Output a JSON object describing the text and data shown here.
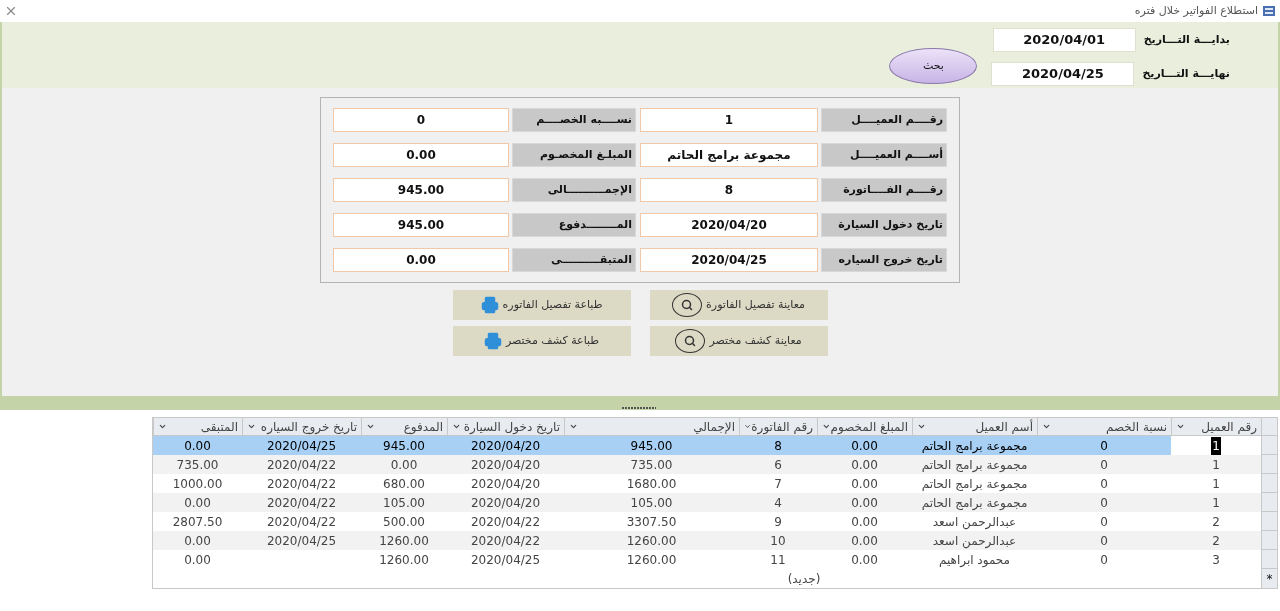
{
  "window": {
    "title": "استطلاع الفواتير خلال فتره"
  },
  "filter": {
    "start_label": "بدايـــة التـــاريخ",
    "start_value": "2020/04/01",
    "end_label": "نهايـــة التـــاريخ",
    "end_value": "2020/04/25",
    "search_button": "بحث"
  },
  "details": [
    {
      "label": "رقــــم العميــــل",
      "value": "1"
    },
    {
      "label": "نســــبه الخصــــم",
      "value": "0"
    },
    {
      "label": "أســــم العميــــل",
      "value": "مجموعة برامج الحاتم"
    },
    {
      "label": "المبلـغ المخصـوم",
      "value": "0.00"
    },
    {
      "label": "رقــــم الفــــاتورة",
      "value": "8"
    },
    {
      "label": "الإجمــــــــــالى",
      "value": "945.00"
    },
    {
      "label": "تاريخ  دخول السيارة",
      "value": "2020/04/20"
    },
    {
      "label": "المــــــــدفوع",
      "value": "945.00"
    },
    {
      "label": "تاريخ  خروج السياره",
      "value": "2020/04/25"
    },
    {
      "label": "المتبقــــــــــى",
      "value": "0.00"
    }
  ],
  "actions": [
    {
      "kind": "preview",
      "label": "معاينة تفصيل الفاتورة"
    },
    {
      "kind": "print",
      "label": "طباعة تفصيل الفاتوره"
    },
    {
      "kind": "preview",
      "label": "معاينة كشف مختصر"
    },
    {
      "kind": "print",
      "label": "طباعة كشف مختصر"
    }
  ],
  "grid": {
    "columns": [
      "رقم العميل",
      "نسبة الخصم",
      "أسم العميل",
      "المبلغ المخصوم",
      "رقم الفاتورة",
      "الإجمالي",
      "تاريخ دخول السيارة",
      "المدفوع",
      "تاريخ خروج السياره",
      "المتبقى"
    ],
    "rows": [
      {
        "selected": true,
        "cells": [
          "1",
          "0",
          "مجموعة برامج الحاتم",
          "0.00",
          "8",
          "945.00",
          "2020/04/20",
          "945.00",
          "2020/04/25",
          "0.00"
        ]
      },
      {
        "selected": false,
        "cells": [
          "1",
          "0",
          "مجموعة برامج الحاتم",
          "0.00",
          "6",
          "735.00",
          "2020/04/20",
          "0.00",
          "2020/04/22",
          "735.00"
        ]
      },
      {
        "selected": false,
        "cells": [
          "1",
          "0",
          "مجموعة برامج الحاتم",
          "0.00",
          "7",
          "1680.00",
          "2020/04/20",
          "680.00",
          "2020/04/22",
          "1000.00"
        ]
      },
      {
        "selected": false,
        "cells": [
          "1",
          "0",
          "مجموعة برامج الحاتم",
          "0.00",
          "4",
          "105.00",
          "2020/04/20",
          "105.00",
          "2020/04/22",
          "0.00"
        ]
      },
      {
        "selected": false,
        "cells": [
          "2",
          "0",
          "عبدالرحمن اسعد",
          "0.00",
          "9",
          "3307.50",
          "2020/04/22",
          "500.00",
          "2020/04/22",
          "2807.50"
        ]
      },
      {
        "selected": false,
        "cells": [
          "2",
          "0",
          "عبدالرحمن اسعد",
          "0.00",
          "10",
          "1260.00",
          "2020/04/22",
          "1260.00",
          "2020/04/25",
          "0.00"
        ]
      },
      {
        "selected": false,
        "cells": [
          "3",
          "0",
          "محمود ابراهيم",
          "0.00",
          "11",
          "1260.00",
          "2020/04/25",
          "1260.00",
          "",
          "0.00"
        ]
      }
    ],
    "new_row_marker": "*",
    "new_row_label": "(جديد)"
  }
}
